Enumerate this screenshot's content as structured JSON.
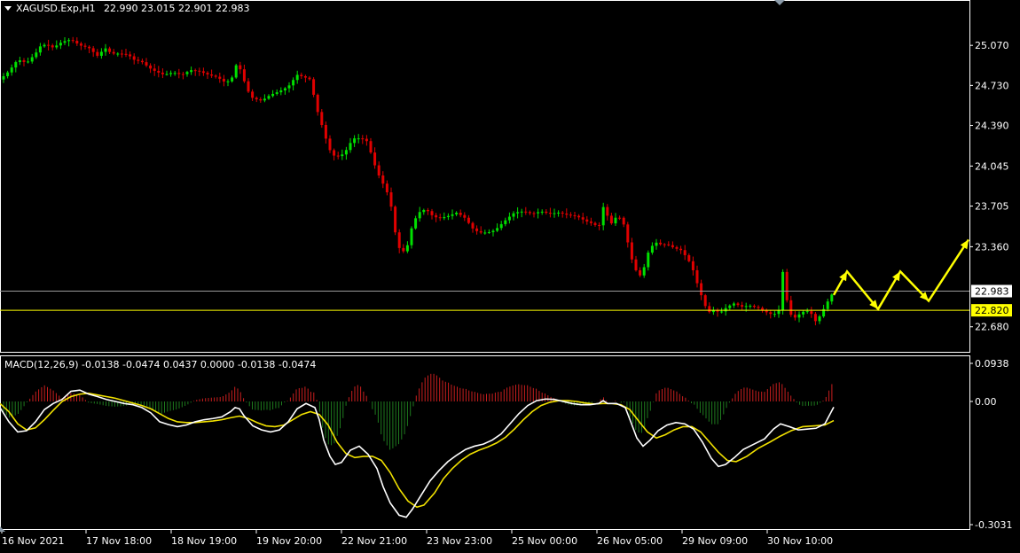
{
  "header": {
    "symbol_label": "XAGUSD.Exp,H1",
    "ohlc_label": "22.990 23.015 22.901 22.983"
  },
  "indicator": {
    "label": "MACD(12,26,9) -0.0138 -0.0474 0.0437 0.0000 -0.0138 -0.0474"
  },
  "colors": {
    "background": "#000000",
    "bull": "#00e000",
    "bear": "#e00000",
    "hist_pos": "#c81e1e",
    "hist_neg": "#1e7a1e",
    "macd_line": "#ffffff",
    "signal_line": "#f0e000",
    "forecast_arrow": "#ffff00",
    "price_line_current": "#9a9a9a",
    "price_line_level": "#ffff00",
    "axis": "#ffffff"
  },
  "chart_data": [
    {
      "type": "candlestick",
      "title": "XAGUSD.Exp,H1",
      "y_ticks": [
        "25.070",
        "24.730",
        "24.390",
        "24.045",
        "23.705",
        "23.360",
        "22.680"
      ],
      "ylim": [
        22.52,
        25.38
      ],
      "price_labels": [
        {
          "name": "current",
          "value": "22.983"
        },
        {
          "name": "level",
          "value": "22.820"
        }
      ],
      "x_ticks": [
        "16 Nov 2021",
        "17 Nov 18:00",
        "18 Nov 19:00",
        "19 Nov 20:00",
        "22 Nov 21:00",
        "23 Nov 23:00",
        "25 Nov 00:00",
        "26 Nov 05:00",
        "29 Nov 09:00",
        "30 Nov 10:00"
      ],
      "close_path": [
        [
          0,
          24.78
        ],
        [
          10,
          24.85
        ],
        [
          20,
          24.95
        ],
        [
          30,
          24.92
        ],
        [
          40,
          25.0
        ],
        [
          45,
          25.06
        ],
        [
          52,
          25.08
        ],
        [
          60,
          25.05
        ],
        [
          70,
          25.1
        ],
        [
          80,
          25.12
        ],
        [
          90,
          25.07
        ],
        [
          100,
          25.05
        ],
        [
          110,
          24.98
        ],
        [
          115,
          25.02
        ],
        [
          120,
          25.05
        ],
        [
          125,
          25.0
        ],
        [
          135,
          25.0
        ],
        [
          145,
          24.99
        ],
        [
          150,
          24.95
        ],
        [
          160,
          24.93
        ],
        [
          168,
          24.88
        ],
        [
          175,
          24.85
        ],
        [
          185,
          24.82
        ],
        [
          195,
          24.84
        ],
        [
          205,
          24.82
        ],
        [
          215,
          24.86
        ],
        [
          225,
          24.85
        ],
        [
          235,
          24.82
        ],
        [
          245,
          24.8
        ],
        [
          255,
          24.75
        ],
        [
          262,
          24.8
        ],
        [
          267,
          24.92
        ],
        [
          272,
          24.85
        ],
        [
          278,
          24.7
        ],
        [
          285,
          24.62
        ],
        [
          295,
          24.6
        ],
        [
          305,
          24.65
        ],
        [
          315,
          24.68
        ],
        [
          325,
          24.72
        ],
        [
          335,
          24.82
        ],
        [
          343,
          24.8
        ],
        [
          350,
          24.78
        ],
        [
          355,
          24.6
        ],
        [
          360,
          24.45
        ],
        [
          365,
          24.35
        ],
        [
          370,
          24.2
        ],
        [
          378,
          24.12
        ],
        [
          388,
          24.15
        ],
        [
          398,
          24.28
        ],
        [
          408,
          24.28
        ],
        [
          415,
          24.25
        ],
        [
          420,
          24.1
        ],
        [
          428,
          23.95
        ],
        [
          435,
          23.85
        ],
        [
          440,
          23.75
        ],
        [
          445,
          23.5
        ],
        [
          450,
          23.35
        ],
        [
          455,
          23.32
        ],
        [
          460,
          23.38
        ],
        [
          465,
          23.55
        ],
        [
          472,
          23.65
        ],
        [
          480,
          23.68
        ],
        [
          488,
          23.62
        ],
        [
          495,
          23.6
        ],
        [
          505,
          23.62
        ],
        [
          515,
          23.65
        ],
        [
          525,
          23.6
        ],
        [
          532,
          23.52
        ],
        [
          540,
          23.48
        ],
        [
          550,
          23.48
        ],
        [
          558,
          23.5
        ],
        [
          565,
          23.55
        ],
        [
          572,
          23.6
        ],
        [
          580,
          23.65
        ],
        [
          590,
          23.66
        ],
        [
          600,
          23.64
        ],
        [
          610,
          23.66
        ],
        [
          620,
          23.64
        ],
        [
          630,
          23.65
        ],
        [
          640,
          23.63
        ],
        [
          650,
          23.62
        ],
        [
          660,
          23.58
        ],
        [
          670,
          23.55
        ],
        [
          675,
          23.52
        ],
        [
          680,
          23.7
        ],
        [
          685,
          23.62
        ],
        [
          690,
          23.55
        ],
        [
          695,
          23.62
        ],
        [
          700,
          23.6
        ],
        [
          705,
          23.52
        ],
        [
          710,
          23.3
        ],
        [
          715,
          23.2
        ],
        [
          720,
          23.1
        ],
        [
          725,
          23.15
        ],
        [
          730,
          23.3
        ],
        [
          738,
          23.4
        ],
        [
          745,
          23.38
        ],
        [
          752,
          23.38
        ],
        [
          760,
          23.35
        ],
        [
          768,
          23.33
        ],
        [
          776,
          23.25
        ],
        [
          782,
          23.15
        ],
        [
          788,
          23.0
        ],
        [
          793,
          22.9
        ],
        [
          798,
          22.8
        ],
        [
          805,
          22.82
        ],
        [
          812,
          22.8
        ],
        [
          820,
          22.85
        ],
        [
          828,
          22.88
        ],
        [
          836,
          22.85
        ],
        [
          845,
          22.86
        ],
        [
          855,
          22.84
        ],
        [
          865,
          22.8
        ],
        [
          872,
          22.78
        ],
        [
          878,
          22.82
        ],
        [
          882,
          23.18
        ],
        [
          886,
          22.95
        ],
        [
          890,
          22.8
        ],
        [
          895,
          22.75
        ],
        [
          900,
          22.78
        ],
        [
          908,
          22.82
        ],
        [
          914,
          22.8
        ],
        [
          920,
          22.72
        ],
        [
          925,
          22.78
        ],
        [
          930,
          22.85
        ],
        [
          935,
          22.92
        ],
        [
          940,
          22.98
        ]
      ],
      "forecast_path": [
        [
          940,
          22.95
        ],
        [
          955,
          23.15
        ],
        [
          990,
          22.83
        ],
        [
          1015,
          23.15
        ],
        [
          1047,
          22.9
        ],
        [
          1092,
          23.42
        ]
      ]
    },
    {
      "type": "macd",
      "title": "MACD(12,26,9)",
      "y_ticks": [
        "0.0938",
        "0.00",
        "-0.3031"
      ],
      "ylim": [
        -0.3031,
        0.0938
      ],
      "macd_values": [
        [
          0,
          -0.015
        ],
        [
          10,
          -0.05
        ],
        [
          20,
          -0.075
        ],
        [
          30,
          -0.072
        ],
        [
          40,
          -0.05
        ],
        [
          50,
          -0.02
        ],
        [
          60,
          -0.005
        ],
        [
          70,
          0.005
        ],
        [
          80,
          0.025
        ],
        [
          90,
          0.028
        ],
        [
          100,
          0.018
        ],
        [
          110,
          0.012
        ],
        [
          120,
          0.005
        ],
        [
          130,
          0.0
        ],
        [
          140,
          -0.005
        ],
        [
          150,
          -0.008
        ],
        [
          160,
          -0.015
        ],
        [
          170,
          -0.028
        ],
        [
          180,
          -0.05
        ],
        [
          190,
          -0.057
        ],
        [
          200,
          -0.062
        ],
        [
          210,
          -0.058
        ],
        [
          220,
          -0.05
        ],
        [
          230,
          -0.045
        ],
        [
          240,
          -0.042
        ],
        [
          250,
          -0.038
        ],
        [
          260,
          -0.025
        ],
        [
          265,
          -0.015
        ],
        [
          270,
          -0.018
        ],
        [
          275,
          -0.035
        ],
        [
          285,
          -0.06
        ],
        [
          295,
          -0.07
        ],
        [
          305,
          -0.075
        ],
        [
          315,
          -0.07
        ],
        [
          325,
          -0.05
        ],
        [
          335,
          -0.018
        ],
        [
          345,
          -0.005
        ],
        [
          355,
          -0.015
        ],
        [
          360,
          -0.045
        ],
        [
          365,
          -0.095
        ],
        [
          372,
          -0.135
        ],
        [
          378,
          -0.155
        ],
        [
          385,
          -0.15
        ],
        [
          395,
          -0.12
        ],
        [
          405,
          -0.11
        ],
        [
          415,
          -0.13
        ],
        [
          425,
          -0.165
        ],
        [
          432,
          -0.21
        ],
        [
          440,
          -0.25
        ],
        [
          450,
          -0.28
        ],
        [
          458,
          -0.285
        ],
        [
          465,
          -0.265
        ],
        [
          475,
          -0.23
        ],
        [
          485,
          -0.195
        ],
        [
          495,
          -0.17
        ],
        [
          505,
          -0.148
        ],
        [
          515,
          -0.132
        ],
        [
          525,
          -0.118
        ],
        [
          535,
          -0.11
        ],
        [
          545,
          -0.105
        ],
        [
          555,
          -0.095
        ],
        [
          565,
          -0.08
        ],
        [
          575,
          -0.055
        ],
        [
          585,
          -0.03
        ],
        [
          595,
          -0.01
        ],
        [
          605,
          0.002
        ],
        [
          615,
          0.006
        ],
        [
          625,
          0.005
        ],
        [
          635,
          0.0
        ],
        [
          645,
          -0.005
        ],
        [
          655,
          -0.008
        ],
        [
          665,
          -0.008
        ],
        [
          675,
          -0.005
        ],
        [
          680,
          0.002
        ],
        [
          685,
          -0.005
        ],
        [
          695,
          -0.005
        ],
        [
          705,
          -0.015
        ],
        [
          712,
          -0.055
        ],
        [
          718,
          -0.09
        ],
        [
          725,
          -0.11
        ],
        [
          733,
          -0.095
        ],
        [
          742,
          -0.072
        ],
        [
          752,
          -0.058
        ],
        [
          762,
          -0.052
        ],
        [
          772,
          -0.055
        ],
        [
          782,
          -0.068
        ],
        [
          792,
          -0.1
        ],
        [
          802,
          -0.14
        ],
        [
          810,
          -0.16
        ],
        [
          818,
          -0.155
        ],
        [
          828,
          -0.138
        ],
        [
          838,
          -0.118
        ],
        [
          850,
          -0.105
        ],
        [
          862,
          -0.092
        ],
        [
          872,
          -0.068
        ],
        [
          880,
          -0.055
        ],
        [
          890,
          -0.062
        ],
        [
          900,
          -0.07
        ],
        [
          910,
          -0.068
        ],
        [
          920,
          -0.066
        ],
        [
          930,
          -0.055
        ],
        [
          940,
          -0.014
        ]
      ],
      "signal_values": [
        [
          0,
          -0.005
        ],
        [
          10,
          -0.025
        ],
        [
          20,
          -0.055
        ],
        [
          30,
          -0.07
        ],
        [
          40,
          -0.065
        ],
        [
          50,
          -0.045
        ],
        [
          60,
          -0.022
        ],
        [
          70,
          0.0
        ],
        [
          80,
          0.012
        ],
        [
          90,
          0.018
        ],
        [
          100,
          0.02
        ],
        [
          110,
          0.016
        ],
        [
          120,
          0.012
        ],
        [
          130,
          0.008
        ],
        [
          140,
          0.002
        ],
        [
          150,
          -0.004
        ],
        [
          160,
          -0.01
        ],
        [
          170,
          -0.018
        ],
        [
          180,
          -0.03
        ],
        [
          190,
          -0.042
        ],
        [
          200,
          -0.05
        ],
        [
          210,
          -0.052
        ],
        [
          220,
          -0.052
        ],
        [
          230,
          -0.05
        ],
        [
          240,
          -0.048
        ],
        [
          250,
          -0.045
        ],
        [
          260,
          -0.04
        ],
        [
          270,
          -0.036
        ],
        [
          280,
          -0.042
        ],
        [
          290,
          -0.052
        ],
        [
          300,
          -0.06
        ],
        [
          310,
          -0.062
        ],
        [
          320,
          -0.058
        ],
        [
          330,
          -0.045
        ],
        [
          340,
          -0.032
        ],
        [
          350,
          -0.025
        ],
        [
          360,
          -0.032
        ],
        [
          370,
          -0.058
        ],
        [
          380,
          -0.1
        ],
        [
          390,
          -0.128
        ],
        [
          400,
          -0.138
        ],
        [
          410,
          -0.135
        ],
        [
          420,
          -0.135
        ],
        [
          430,
          -0.145
        ],
        [
          440,
          -0.175
        ],
        [
          450,
          -0.215
        ],
        [
          460,
          -0.245
        ],
        [
          470,
          -0.26
        ],
        [
          478,
          -0.255
        ],
        [
          490,
          -0.225
        ],
        [
          500,
          -0.19
        ],
        [
          510,
          -0.165
        ],
        [
          520,
          -0.145
        ],
        [
          530,
          -0.13
        ],
        [
          540,
          -0.12
        ],
        [
          550,
          -0.112
        ],
        [
          560,
          -0.102
        ],
        [
          570,
          -0.088
        ],
        [
          580,
          -0.068
        ],
        [
          590,
          -0.045
        ],
        [
          600,
          -0.025
        ],
        [
          610,
          -0.01
        ],
        [
          620,
          -0.002
        ],
        [
          630,
          0.002
        ],
        [
          640,
          0.002
        ],
        [
          650,
          0.0
        ],
        [
          660,
          -0.004
        ],
        [
          670,
          -0.006
        ],
        [
          680,
          -0.005
        ],
        [
          690,
          -0.005
        ],
        [
          700,
          -0.008
        ],
        [
          710,
          -0.02
        ],
        [
          720,
          -0.048
        ],
        [
          730,
          -0.075
        ],
        [
          740,
          -0.09
        ],
        [
          750,
          -0.082
        ],
        [
          760,
          -0.07
        ],
        [
          770,
          -0.062
        ],
        [
          780,
          -0.062
        ],
        [
          790,
          -0.075
        ],
        [
          800,
          -0.1
        ],
        [
          810,
          -0.125
        ],
        [
          820,
          -0.145
        ],
        [
          830,
          -0.148
        ],
        [
          842,
          -0.135
        ],
        [
          855,
          -0.115
        ],
        [
          868,
          -0.1
        ],
        [
          880,
          -0.085
        ],
        [
          892,
          -0.072
        ],
        [
          905,
          -0.062
        ],
        [
          918,
          -0.06
        ],
        [
          930,
          -0.058
        ],
        [
          940,
          -0.047
        ]
      ]
    }
  ]
}
